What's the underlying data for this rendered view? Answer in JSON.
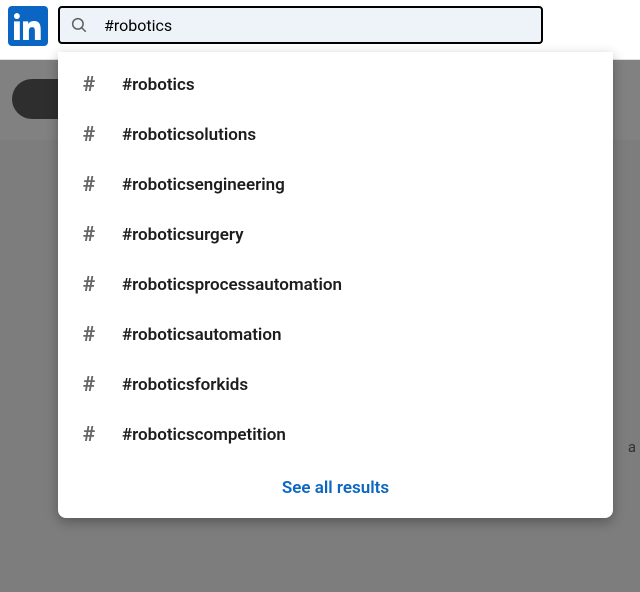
{
  "search": {
    "value": "#robotics",
    "placeholder": "Search"
  },
  "suggestions": [
    {
      "label": "#robotics"
    },
    {
      "label": "#roboticsolutions"
    },
    {
      "label": "#roboticsengineering"
    },
    {
      "label": "#roboticsurgery"
    },
    {
      "label": "#roboticsprocessautomation"
    },
    {
      "label": "#roboticsautomation"
    },
    {
      "label": "#roboticsforkids"
    },
    {
      "label": "#roboticscompetition"
    }
  ],
  "see_all_label": "See all results",
  "bg_side_text": "a"
}
